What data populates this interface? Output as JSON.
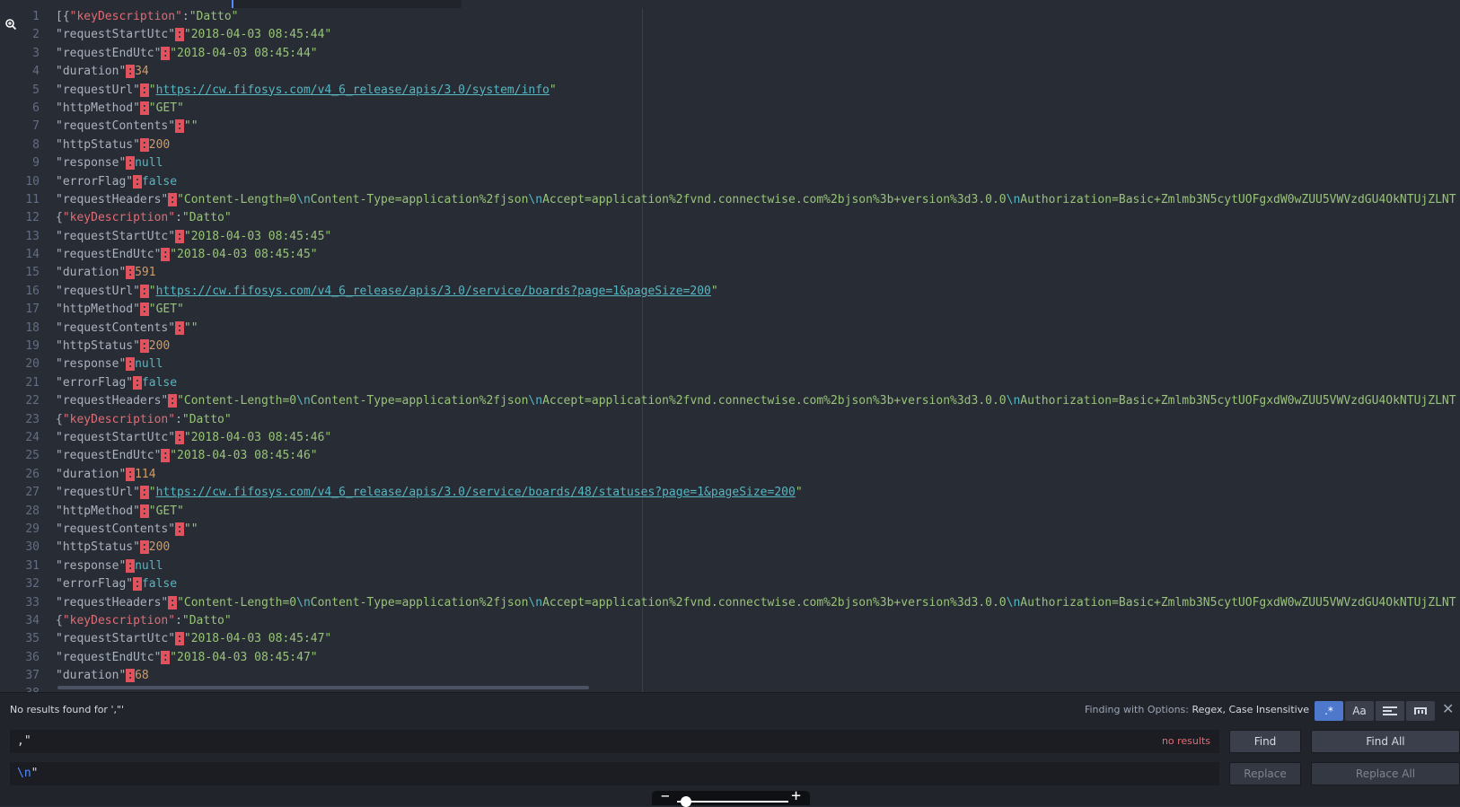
{
  "editor": {
    "lines": [
      {
        "n": "1",
        "segs": [
          [
            "code",
            "["
          ],
          [
            "code",
            "{"
          ],
          [
            "pkey",
            "\"keyDescription\""
          ],
          [
            "code",
            ":"
          ],
          [
            "str",
            "\"Datto\""
          ]
        ]
      },
      {
        "n": "2",
        "segs": [
          [
            "key",
            "\"requestStartUtc\""
          ],
          [
            "colon",
            ":"
          ],
          [
            "str",
            "\"2018-04-03 08:45:44\""
          ]
        ]
      },
      {
        "n": "3",
        "segs": [
          [
            "key",
            "\"requestEndUtc\""
          ],
          [
            "colon",
            ":"
          ],
          [
            "str",
            "\"2018-04-03 08:45:44\""
          ]
        ]
      },
      {
        "n": "4",
        "segs": [
          [
            "key",
            "\"duration\""
          ],
          [
            "colon",
            ":"
          ],
          [
            "nm",
            "34"
          ]
        ]
      },
      {
        "n": "5",
        "segs": [
          [
            "key",
            "\"requestUrl\""
          ],
          [
            "colon",
            ":"
          ],
          [
            "str",
            "\""
          ],
          [
            "url",
            "https://cw.fifosys.com/v4_6_release/apis/3.0/system/info"
          ],
          [
            "str",
            "\""
          ]
        ]
      },
      {
        "n": "6",
        "segs": [
          [
            "key",
            "\"httpMethod\""
          ],
          [
            "colon",
            ":"
          ],
          [
            "str",
            "\"GET\""
          ]
        ]
      },
      {
        "n": "7",
        "segs": [
          [
            "key",
            "\"requestContents\""
          ],
          [
            "colon",
            ":"
          ],
          [
            "str",
            "\"\""
          ]
        ]
      },
      {
        "n": "8",
        "segs": [
          [
            "key",
            "\"httpStatus\""
          ],
          [
            "colon",
            ":"
          ],
          [
            "nm",
            "200"
          ]
        ]
      },
      {
        "n": "9",
        "segs": [
          [
            "key",
            "\"response\""
          ],
          [
            "colon",
            ":"
          ],
          [
            "kw",
            "null"
          ]
        ]
      },
      {
        "n": "10",
        "segs": [
          [
            "key",
            "\"errorFlag\""
          ],
          [
            "colon",
            ":"
          ],
          [
            "kw",
            "false"
          ]
        ]
      },
      {
        "n": "11",
        "segs": [
          [
            "key",
            "\"requestHeaders\""
          ],
          [
            "colon",
            ":"
          ],
          [
            "str",
            "\"Content-Length=0"
          ],
          [
            "esc",
            "\\n"
          ],
          [
            "str",
            "Content-Type=application%2fjson"
          ],
          [
            "esc",
            "\\n"
          ],
          [
            "str",
            "Accept=application%2fvnd.connectwise.com%2bjson%3b+version%3d3.0.0"
          ],
          [
            "esc",
            "\\n"
          ],
          [
            "str",
            "Authorization=Basic+Zmlmb3N5cytUOFgxdW0wZUU5VWVzdGU4OkNTUjZLNT"
          ]
        ]
      },
      {
        "n": "12",
        "segs": [
          [
            "code",
            "{"
          ],
          [
            "pkey",
            "\"keyDescription\""
          ],
          [
            "code",
            ":"
          ],
          [
            "str",
            "\"Datto\""
          ]
        ]
      },
      {
        "n": "13",
        "segs": [
          [
            "key",
            "\"requestStartUtc\""
          ],
          [
            "colon",
            ":"
          ],
          [
            "str",
            "\"2018-04-03 08:45:45\""
          ]
        ]
      },
      {
        "n": "14",
        "segs": [
          [
            "key",
            "\"requestEndUtc\""
          ],
          [
            "colon",
            ":"
          ],
          [
            "str",
            "\"2018-04-03 08:45:45\""
          ]
        ]
      },
      {
        "n": "15",
        "segs": [
          [
            "key",
            "\"duration\""
          ],
          [
            "colon",
            ":"
          ],
          [
            "nm",
            "591"
          ]
        ]
      },
      {
        "n": "16",
        "segs": [
          [
            "key",
            "\"requestUrl\""
          ],
          [
            "colon",
            ":"
          ],
          [
            "str",
            "\""
          ],
          [
            "url",
            "https://cw.fifosys.com/v4_6_release/apis/3.0/service/boards?page=1&pageSize=200"
          ],
          [
            "str",
            "\""
          ]
        ]
      },
      {
        "n": "17",
        "segs": [
          [
            "key",
            "\"httpMethod\""
          ],
          [
            "colon",
            ":"
          ],
          [
            "str",
            "\"GET\""
          ]
        ]
      },
      {
        "n": "18",
        "segs": [
          [
            "key",
            "\"requestContents\""
          ],
          [
            "colon",
            ":"
          ],
          [
            "str",
            "\"\""
          ]
        ]
      },
      {
        "n": "19",
        "segs": [
          [
            "key",
            "\"httpStatus\""
          ],
          [
            "colon",
            ":"
          ],
          [
            "nm",
            "200"
          ]
        ]
      },
      {
        "n": "20",
        "segs": [
          [
            "key",
            "\"response\""
          ],
          [
            "colon",
            ":"
          ],
          [
            "kw",
            "null"
          ]
        ]
      },
      {
        "n": "21",
        "segs": [
          [
            "key",
            "\"errorFlag\""
          ],
          [
            "colon",
            ":"
          ],
          [
            "kw",
            "false"
          ]
        ]
      },
      {
        "n": "22",
        "segs": [
          [
            "key",
            "\"requestHeaders\""
          ],
          [
            "colon",
            ":"
          ],
          [
            "str",
            "\"Content-Length=0"
          ],
          [
            "esc",
            "\\n"
          ],
          [
            "str",
            "Content-Type=application%2fjson"
          ],
          [
            "esc",
            "\\n"
          ],
          [
            "str",
            "Accept=application%2fvnd.connectwise.com%2bjson%3b+version%3d3.0.0"
          ],
          [
            "esc",
            "\\n"
          ],
          [
            "str",
            "Authorization=Basic+Zmlmb3N5cytUOFgxdW0wZUU5VWVzdGU4OkNTUjZLNT"
          ]
        ]
      },
      {
        "n": "23",
        "segs": [
          [
            "code",
            "{"
          ],
          [
            "pkey",
            "\"keyDescription\""
          ],
          [
            "code",
            ":"
          ],
          [
            "str",
            "\"Datto\""
          ]
        ]
      },
      {
        "n": "24",
        "segs": [
          [
            "key",
            "\"requestStartUtc\""
          ],
          [
            "colon",
            ":"
          ],
          [
            "str",
            "\"2018-04-03 08:45:46\""
          ]
        ]
      },
      {
        "n": "25",
        "segs": [
          [
            "key",
            "\"requestEndUtc\""
          ],
          [
            "colon",
            ":"
          ],
          [
            "str",
            "\"2018-04-03 08:45:46\""
          ]
        ]
      },
      {
        "n": "26",
        "segs": [
          [
            "key",
            "\"duration\""
          ],
          [
            "colon",
            ":"
          ],
          [
            "nm",
            "114"
          ]
        ]
      },
      {
        "n": "27",
        "segs": [
          [
            "key",
            "\"requestUrl\""
          ],
          [
            "colon",
            ":"
          ],
          [
            "str",
            "\""
          ],
          [
            "url",
            "https://cw.fifosys.com/v4_6_release/apis/3.0/service/boards/48/statuses?page=1&pageSize=200"
          ],
          [
            "str",
            "\""
          ]
        ]
      },
      {
        "n": "28",
        "segs": [
          [
            "key",
            "\"httpMethod\""
          ],
          [
            "colon",
            ":"
          ],
          [
            "str",
            "\"GET\""
          ]
        ]
      },
      {
        "n": "29",
        "segs": [
          [
            "key",
            "\"requestContents\""
          ],
          [
            "colon",
            ":"
          ],
          [
            "str",
            "\"\""
          ]
        ]
      },
      {
        "n": "30",
        "segs": [
          [
            "key",
            "\"httpStatus\""
          ],
          [
            "colon",
            ":"
          ],
          [
            "nm",
            "200"
          ]
        ]
      },
      {
        "n": "31",
        "segs": [
          [
            "key",
            "\"response\""
          ],
          [
            "colon",
            ":"
          ],
          [
            "kw",
            "null"
          ]
        ]
      },
      {
        "n": "32",
        "segs": [
          [
            "key",
            "\"errorFlag\""
          ],
          [
            "colon",
            ":"
          ],
          [
            "kw",
            "false"
          ]
        ]
      },
      {
        "n": "33",
        "segs": [
          [
            "key",
            "\"requestHeaders\""
          ],
          [
            "colon",
            ":"
          ],
          [
            "str",
            "\"Content-Length=0"
          ],
          [
            "esc",
            "\\n"
          ],
          [
            "str",
            "Content-Type=application%2fjson"
          ],
          [
            "esc",
            "\\n"
          ],
          [
            "str",
            "Accept=application%2fvnd.connectwise.com%2bjson%3b+version%3d3.0.0"
          ],
          [
            "esc",
            "\\n"
          ],
          [
            "str",
            "Authorization=Basic+Zmlmb3N5cytUOFgxdW0wZUU5VWVzdGU4OkNTUjZLNT"
          ]
        ]
      },
      {
        "n": "34",
        "segs": [
          [
            "code",
            "{"
          ],
          [
            "pkey",
            "\"keyDescription\""
          ],
          [
            "code",
            ":"
          ],
          [
            "str",
            "\"Datto\""
          ]
        ]
      },
      {
        "n": "35",
        "segs": [
          [
            "key",
            "\"requestStartUtc\""
          ],
          [
            "colon",
            ":"
          ],
          [
            "str",
            "\"2018-04-03 08:45:47\""
          ]
        ]
      },
      {
        "n": "36",
        "segs": [
          [
            "key",
            "\"requestEndUtc\""
          ],
          [
            "colon",
            ":"
          ],
          [
            "str",
            "\"2018-04-03 08:45:47\""
          ]
        ]
      },
      {
        "n": "37",
        "segs": [
          [
            "key",
            "\"duration\""
          ],
          [
            "colon",
            ":"
          ],
          [
            "nm",
            "68"
          ]
        ]
      },
      {
        "n": "38",
        "segs": []
      }
    ]
  },
  "find": {
    "status": "No results found for ',\"'",
    "options_prefix": "Finding with Options:",
    "options_value": "Regex, Case Insensitive",
    "regex_label": ".*",
    "case_label": "Aa",
    "find_value": ",\"",
    "no_results": "no results",
    "replace_escape": "\\n",
    "replace_rest": "\"",
    "find_button": "Find",
    "find_all_button": "Find All",
    "replace_button": "Replace",
    "replace_all_button": "Replace All",
    "close_label": "✕"
  },
  "colors": {
    "background": "#282c34",
    "accent": "#4d78cc",
    "error": "#e06c75",
    "string": "#98c379",
    "keyword": "#56b6c2",
    "number": "#d19a66"
  }
}
